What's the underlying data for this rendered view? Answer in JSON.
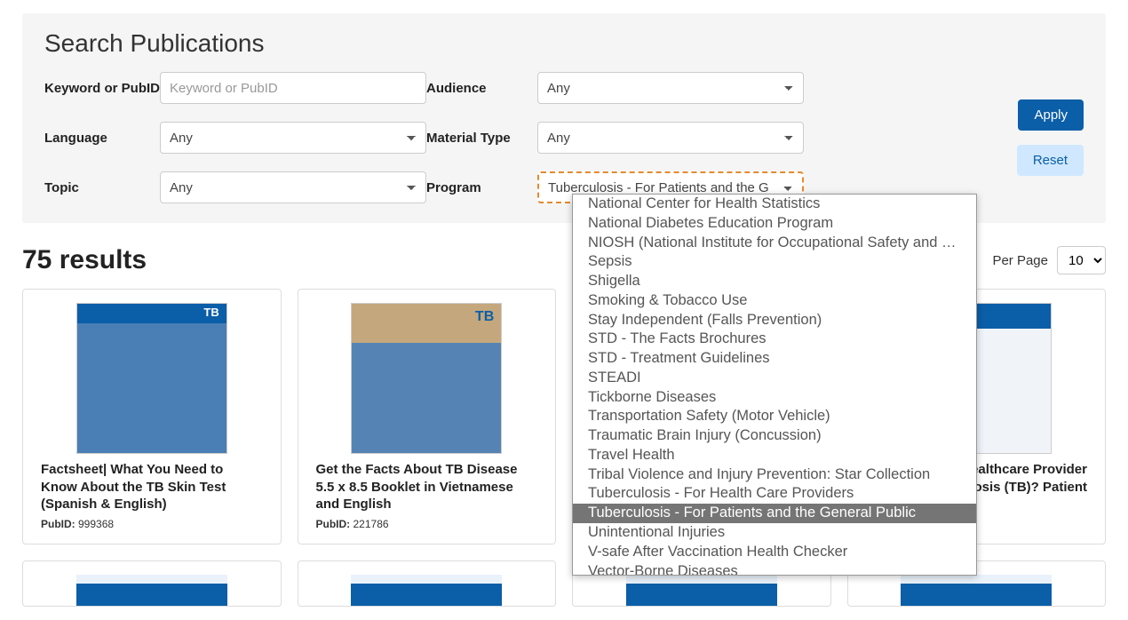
{
  "search": {
    "title": "Search Publications",
    "fields": {
      "keyword": {
        "label": "Keyword or PubID",
        "placeholder": "Keyword or PubID"
      },
      "audience": {
        "label": "Audience",
        "selected": "Any"
      },
      "language": {
        "label": "Language",
        "selected": "Any"
      },
      "material_type": {
        "label": "Material Type",
        "selected": "Any"
      },
      "topic": {
        "label": "Topic",
        "selected": "Any"
      },
      "program": {
        "label": "Program",
        "selected_display": "Tuberculosis - For Patients and the G"
      }
    },
    "buttons": {
      "apply": "Apply",
      "reset": "Reset"
    }
  },
  "program_dropdown": {
    "selected_value": "Tuberculosis - For Patients and the General Public",
    "options": [
      "National Center for Health Statistics",
      "National Diabetes Education Program",
      "NIOSH (National Institute for Occupational Safety and Health)",
      "Sepsis",
      "Shigella",
      "Smoking & Tobacco Use",
      "Stay Independent (Falls Prevention)",
      "STD - The Facts Brochures",
      "STD - Treatment Guidelines",
      "STEADI",
      "Tickborne Diseases",
      "Transportation Safety (Motor Vehicle)",
      "Traumatic Brain Injury (Concussion)",
      "Travel Health",
      "Tribal Violence and Injury Prevention: Star Collection",
      "Tuberculosis - For Health Care Providers",
      "Tuberculosis - For Patients and the General Public",
      "Unintentional Injuries",
      "V-safe After Vaccination Health Checker",
      "Vector-Borne Diseases"
    ]
  },
  "results": {
    "count_text": "75 results",
    "per_page_label": "Per Page",
    "per_page_value": "10"
  },
  "pubid_label": "PubID:",
  "cards": [
    {
      "title": "Factsheet| What You Need to Know About the TB Skin Test (Spanish & English)",
      "pubid": "999368",
      "thumb_class": "t1"
    },
    {
      "title": "Get the Facts About TB Disease 5.5 x 8.5 Booklet in Vietnamese and English",
      "pubid": "221786",
      "thumb_class": "t2"
    },
    {
      "title": "",
      "pubid": "",
      "thumb_class": "t3"
    },
    {
      "title": "Healthcare Provider ... rculosis (TB)? Patient",
      "pubid": "",
      "thumb_class": "t4",
      "title_partial_prefix": "r Healthcare Provider",
      "title_partial_suffix": "rculosis (TB)? Patient"
    }
  ]
}
